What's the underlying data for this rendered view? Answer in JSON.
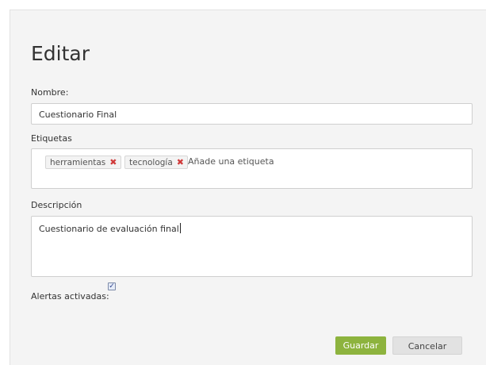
{
  "dialog": {
    "title": "Editar",
    "name_label": "Nombre:",
    "name_value": "Cuestionario Final",
    "tags_label": "Etiquetas",
    "tags": [
      {
        "label": "herramientas",
        "remove_icon": "close-icon"
      },
      {
        "label": "tecnología",
        "remove_icon": "close-icon"
      }
    ],
    "tag_placeholder": "Añade una etiqueta",
    "description_label": "Descripción",
    "description_value": "Cuestionario de evaluación final",
    "alerts_label": "Alertas activadas:",
    "alerts_enabled": true,
    "save_label": "Guardar",
    "cancel_label": "Cancelar"
  },
  "colors": {
    "accent": "#8db33e",
    "remove_x": "#d03a3a",
    "panel_bg": "#f4f4f4"
  }
}
